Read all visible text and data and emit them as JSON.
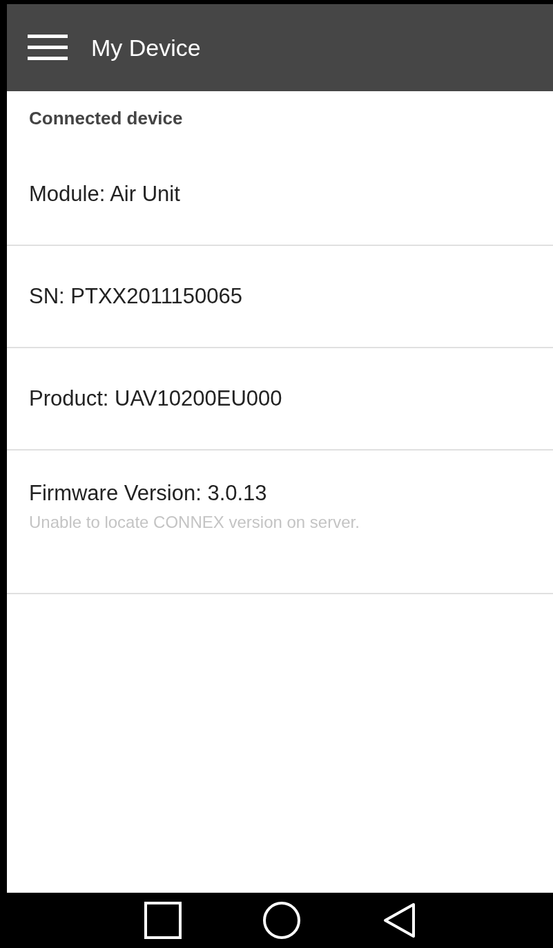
{
  "app_bar": {
    "title": "My Device"
  },
  "section_header": "Connected device",
  "items": [
    {
      "title": "Module: Air Unit"
    },
    {
      "title": "SN: PTXX2011150065"
    },
    {
      "title": "Product: UAV10200EU000"
    },
    {
      "title": "Firmware Version: 3.0.13",
      "subtitle": "Unable to locate CONNEX version on server."
    }
  ],
  "nav_bar": {
    "buttons": [
      {
        "kind": "recents"
      },
      {
        "kind": "home"
      },
      {
        "kind": "back"
      }
    ]
  }
}
